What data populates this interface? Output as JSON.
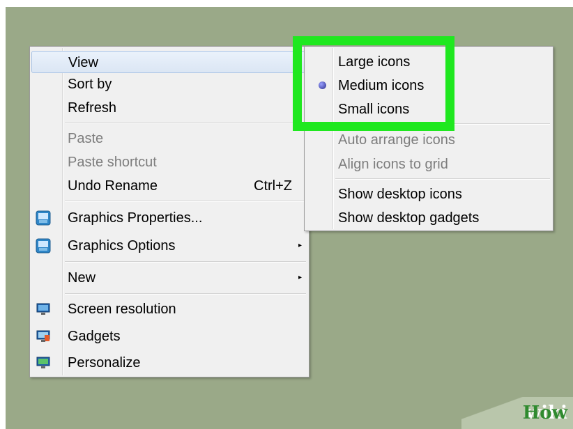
{
  "context_menu": {
    "items": [
      {
        "label": "View",
        "highlighted": true
      },
      {
        "label": "Sort by"
      },
      {
        "label": "Refresh"
      },
      {
        "label": "Paste",
        "disabled": true
      },
      {
        "label": "Paste shortcut",
        "disabled": true
      },
      {
        "label": "Undo Rename",
        "shortcut": "Ctrl+Z"
      },
      {
        "label": "Graphics Properties...",
        "icon": "graphics-icon"
      },
      {
        "label": "Graphics Options",
        "icon": "graphics-icon",
        "submenu": true
      },
      {
        "label": "New",
        "submenu": true
      },
      {
        "label": "Screen resolution",
        "icon": "monitor-icon"
      },
      {
        "label": "Gadgets",
        "icon": "gadgets-icon"
      },
      {
        "label": "Personalize",
        "icon": "personalize-icon"
      }
    ]
  },
  "view_submenu": {
    "items": [
      {
        "label": "Large icons"
      },
      {
        "label": "Medium icons",
        "selected": true
      },
      {
        "label": "Small icons"
      },
      {
        "label": "Auto arrange icons",
        "disabled": true
      },
      {
        "label": "Align icons to grid",
        "disabled": true
      },
      {
        "label": "Show desktop icons"
      },
      {
        "label": "Show desktop gadgets"
      }
    ]
  },
  "annotation": {
    "highlight_color": "#1fe81f"
  },
  "watermark": {
    "part1": "wiki",
    "part2": "How"
  },
  "colors": {
    "desktop": "#9aa988",
    "menu_bg": "#f0f0f0",
    "disabled_text": "#7d7d7d"
  }
}
